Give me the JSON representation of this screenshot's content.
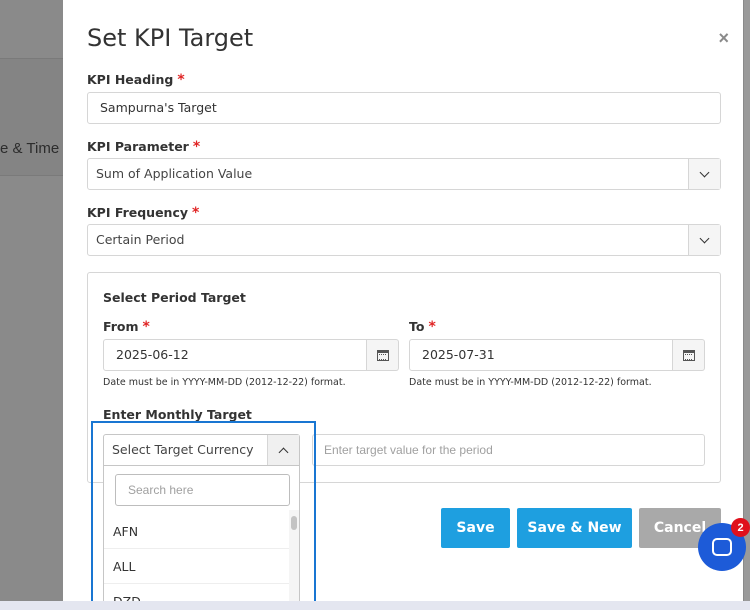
{
  "background": {
    "column_label": "e & Time"
  },
  "modal": {
    "title": "Set KPI Target",
    "close_symbol": "×",
    "kpi_heading": {
      "label": "KPI Heading",
      "required": "*",
      "value": "Sampurna's Target"
    },
    "kpi_parameter": {
      "label": "KPI Parameter",
      "required": "*",
      "value": "Sum of Application Value"
    },
    "kpi_frequency": {
      "label": "KPI Frequency",
      "required": "*",
      "value": "Certain Period"
    },
    "period": {
      "title": "Select Period Target",
      "from": {
        "label": "From",
        "required": "*",
        "value": "2025-06-12",
        "hint": "Date must be in YYYY-MM-DD (2012-12-22) format."
      },
      "to": {
        "label": "To",
        "required": "*",
        "value": "2025-07-31",
        "hint": "Date must be in YYYY-MM-DD (2012-12-22) format."
      },
      "monthly_target_label": "Enter Monthly Target",
      "currency": {
        "selected": "Select Target Currency",
        "search_placeholder": "Search here",
        "options": [
          "AFN",
          "ALL",
          "DZD"
        ]
      },
      "target_placeholder": "Enter target value for the period"
    },
    "buttons": {
      "save": "Save",
      "save_new": "Save & New",
      "cancel": "Cancel"
    }
  },
  "chat": {
    "badge_count": "2"
  },
  "colors": {
    "primary": "#1e9fe0",
    "cancel": "#a9a9a9",
    "required": "#e02424",
    "chat": "#1d5bd8",
    "badge": "#e0101c",
    "highlight": "#1976d2"
  }
}
